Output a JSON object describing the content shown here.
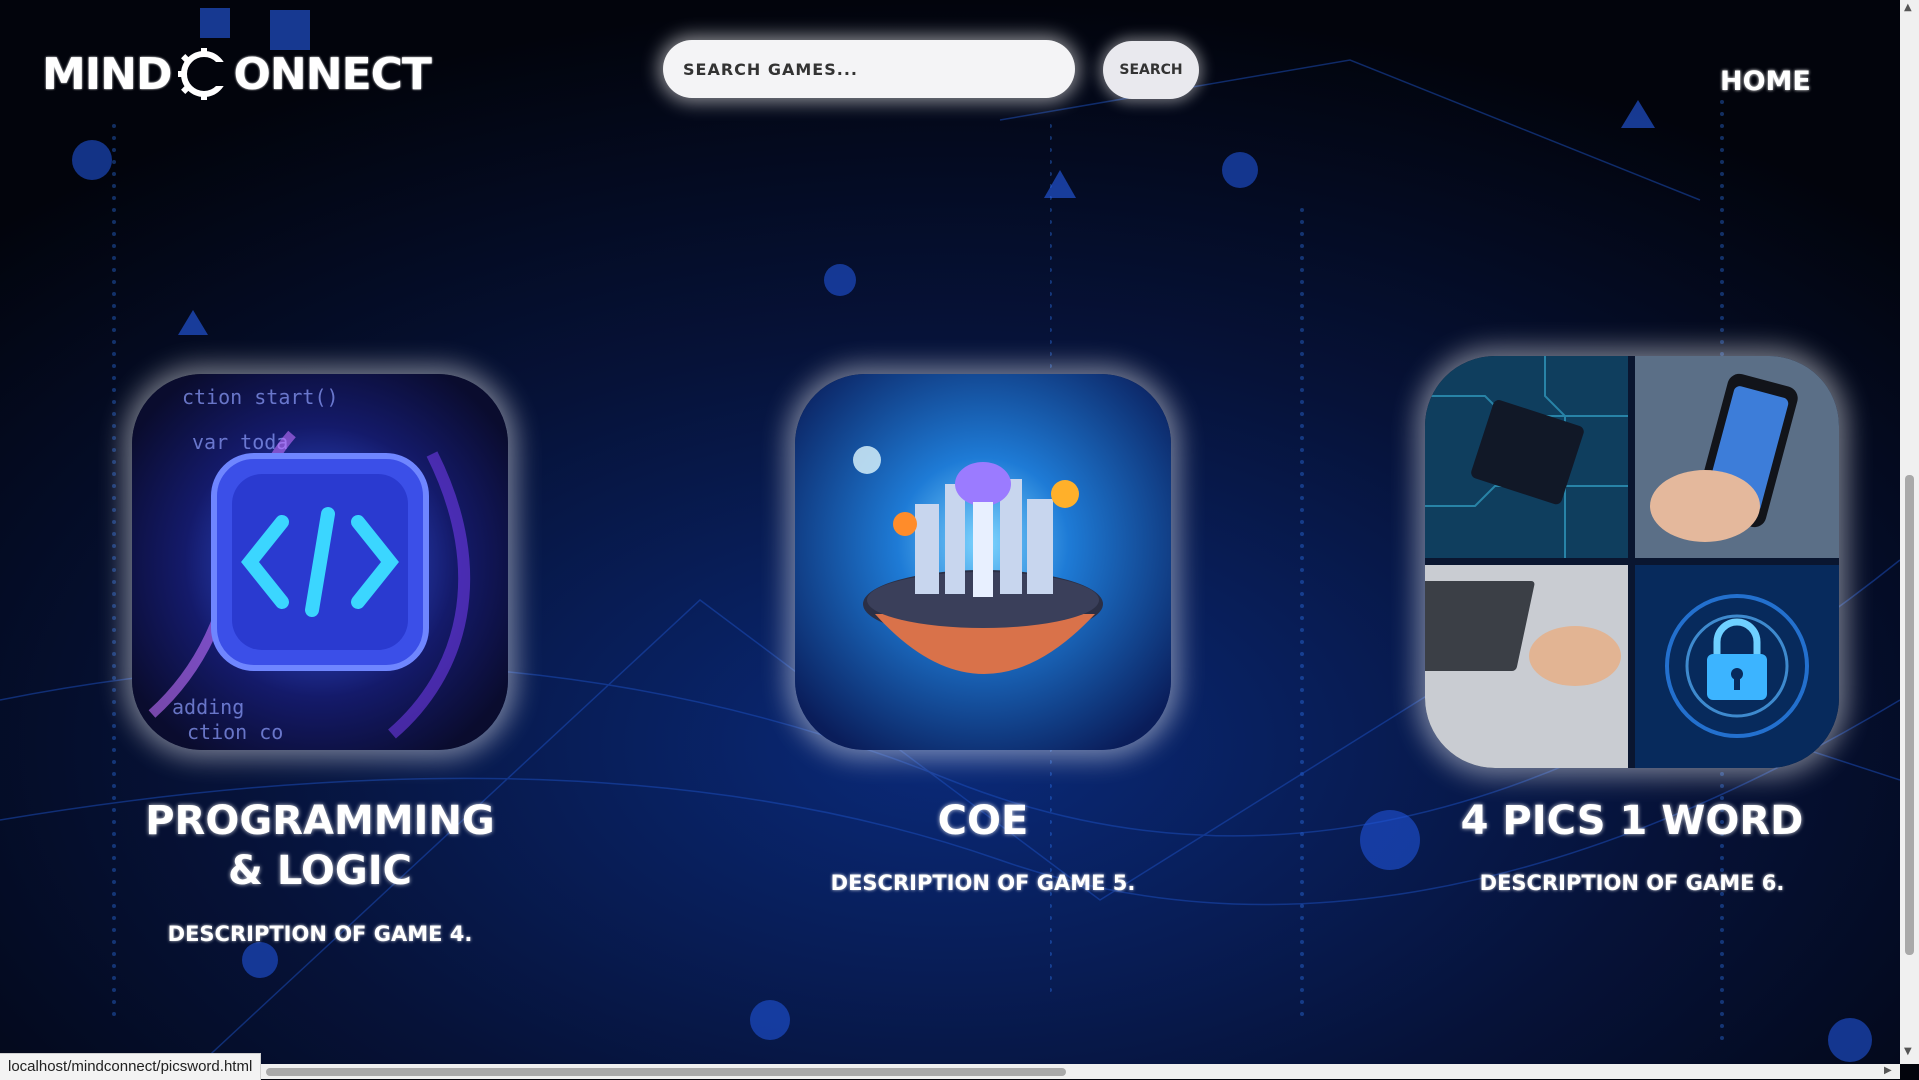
{
  "logo": {
    "part1": "MIND",
    "part2": "ONNECT"
  },
  "search": {
    "placeholder": "SEARCH GAMES...",
    "button_label": "SEARCH"
  },
  "nav": {
    "home_label": "HOME"
  },
  "cards": [
    {
      "title": "PROGRAMMING & LOGIC",
      "description": "DESCRIPTION OF GAME 4."
    },
    {
      "title": "COE",
      "description": "DESCRIPTION OF GAME 5."
    },
    {
      "title": "4 PICS 1 WORD",
      "description": "DESCRIPTION OF GAME 6."
    }
  ],
  "status_bar": {
    "url": "localhost/mindconnect/picsword.html"
  },
  "code_image": {
    "lines": [
      "ction start()",
      "var toda",
      "adding",
      "ction co"
    ]
  },
  "colors": {
    "background": "#02040c",
    "glow": "#ffffff",
    "accent_blue": "#1e5cff"
  }
}
